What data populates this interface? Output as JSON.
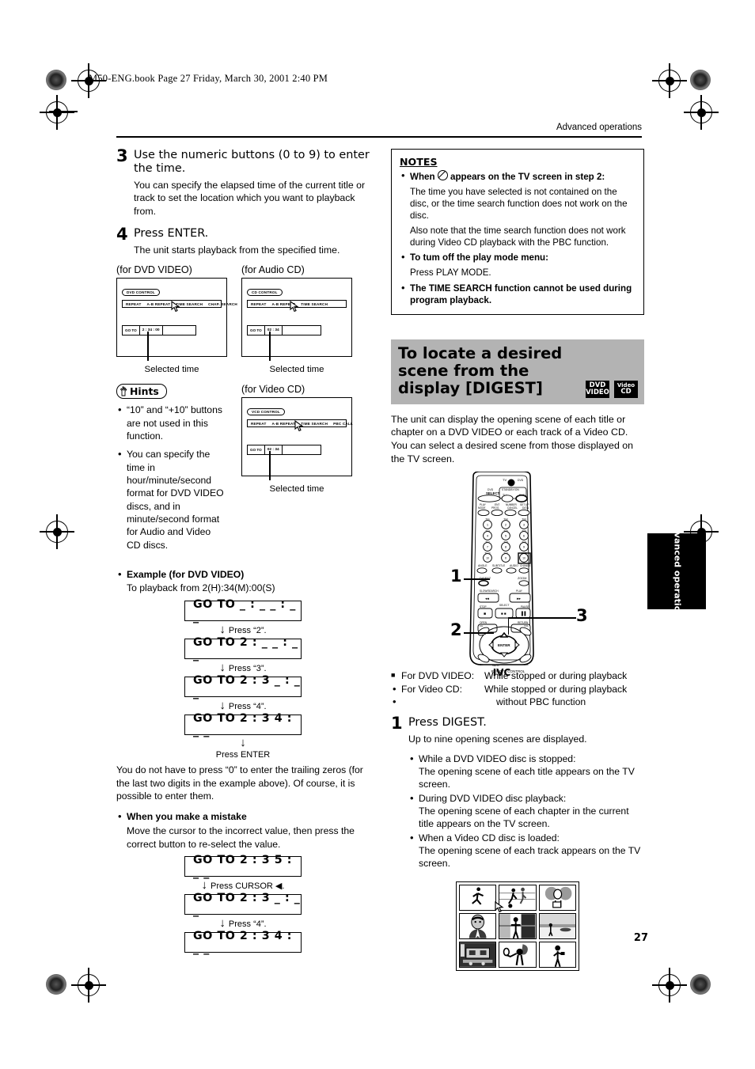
{
  "header": {
    "bookline": "M50-ENG.book  Page 27  Friday, March 30, 2001  2:40 PM",
    "running_head": "Advanced operations",
    "page_number": "27",
    "side_tab": "Advanced operations"
  },
  "left_column": {
    "step3": {
      "num": "3",
      "title": "Use the numeric buttons (0 to 9) to enter the time.",
      "body": "You can specify the elapsed time of the current title or track to set the location which you want to playback from."
    },
    "step4": {
      "num": "4",
      "title": "Press ENTER.",
      "body": "The unit starts playback from the specified time."
    },
    "osd_dvd": {
      "caption": "(for DVD VIDEO)",
      "control_label": "DVD CONTROL",
      "menu_items": [
        "REPEAT",
        "A-B REPEAT",
        "TIME SEARCH",
        "CHAP. SEARCH"
      ],
      "goto_label": "GO TO",
      "goto_value": "2 : 34 : 00",
      "selected_caption": "Selected time"
    },
    "osd_cd": {
      "caption": "(for Audio CD)",
      "control_label": "CD CONTROL",
      "menu_items": [
        "REPEAT",
        "A-B REPEAT",
        "TIME SEARCH"
      ],
      "goto_label": "GO TO",
      "goto_value": "02 : 34",
      "selected_caption": "Selected time"
    },
    "osd_vcd": {
      "caption": "(for Video CD)",
      "control_label": "VCD CONTROL",
      "menu_items": [
        "REPEAT",
        "A-B REPEAT",
        "TIME SEARCH",
        "PBC CALL"
      ],
      "goto_label": "GO TO",
      "goto_value": "02 : 34",
      "selected_caption": "Selected time"
    },
    "hints": {
      "badge": "Hints",
      "items": [
        "“10” and “+10” buttons are not used in this function.",
        "You can specify the time in hour/minute/second format for DVD VIDEO discs, and in minute/second format for Audio and Video CD discs."
      ]
    },
    "example": {
      "heading": "Example (for DVD VIDEO)",
      "subtitle": "To playback from 2(H):34(M):00(S)",
      "steps": [
        {
          "display": "GO TO _ : _ _ : _ _",
          "action": "Press “2”."
        },
        {
          "display": "GO TO 2 : _ _ : _ _",
          "action": "Press “3”."
        },
        {
          "display": "GO TO 2 : 3 _ : _ _",
          "action": "Press “4”."
        },
        {
          "display": "GO TO 2 : 3 4 : _ _",
          "action": "Press ENTER"
        }
      ]
    },
    "trailing_note": "You do not have to press “0” to enter the trailing zeros (for the last two digits in the example above). Of course, it is possible to enter them.",
    "mistake": {
      "heading": "When you make a mistake",
      "body": "Move the cursor to the incorrect value, then press the correct button to re-select the value.",
      "steps": [
        {
          "display": "GO TO 2 : 3 5 : _ _",
          "action": "Press CURSOR ◀."
        },
        {
          "display": "GO TO 2 : 3 _ : _ _",
          "action": "Press “4”."
        },
        {
          "display": "GO TO 2 : 3 4 : _ _",
          "action": ""
        }
      ]
    }
  },
  "right_column": {
    "notes": {
      "title": "NOTES",
      "items": [
        {
          "bold_pre": "When",
          "symbol": "no-entry-icon",
          "bold_post": "appears on the TV screen in step 2:",
          "subs": [
            "The time you have selected is not contained on the disc, or the time search function does not work on the disc.",
            "Also note that the time search function does not work during Video CD playback with the PBC function."
          ]
        },
        {
          "bold": "To tum off the play mode menu:",
          "subs": [
            "Press PLAY MODE."
          ]
        },
        {
          "bold": "The TIME SEARCH function cannot be used during program playback.",
          "subs": []
        }
      ]
    },
    "section": {
      "title": "To locate a desired scene from the display [DIGEST]",
      "badges": [
        {
          "line1": "DVD",
          "line2": "VIDEO"
        },
        {
          "line1": "Video",
          "line2": "CD"
        }
      ],
      "intro": "The unit can display the opening scene of each title or chapter on a DVD VIDEO or each track of a Video CD.  You can select a desired scene from those displayed on the TV screen."
    },
    "remote": {
      "brand": "JVC",
      "sub_brand": "REMOTE CONTROL",
      "callouts": [
        "1",
        "2",
        "3"
      ]
    },
    "applies": [
      {
        "label": "For DVD VIDEO:",
        "value": "While stopped or during playback"
      },
      {
        "label": "For Video CD:",
        "value": "While stopped or during playback"
      },
      {
        "label": "",
        "value": "without PBC function"
      }
    ],
    "step1": {
      "num": "1",
      "title": "Press DIGEST.",
      "body": "Up to nine opening scenes are displayed.",
      "bullets": [
        {
          "head": "While a DVD VIDEO disc is stopped:",
          "text": "The opening scene of each title appears on the TV screen."
        },
        {
          "head": "During DVD VIDEO disc playback:",
          "text": "The opening scene of each chapter in the current title appears on the TV screen."
        },
        {
          "head": "When a Video CD disc is loaded:",
          "text": "The opening scene of each track appears on the TV screen."
        }
      ]
    },
    "digest_thumbnails": [
      "runner-scene",
      "soccer-scene",
      "two-heads-scene",
      "man-portrait-scene",
      "person-fence-scene",
      "beach-scene",
      "train-scene",
      "trumpet-player-scene",
      "standing-person-scene"
    ]
  }
}
